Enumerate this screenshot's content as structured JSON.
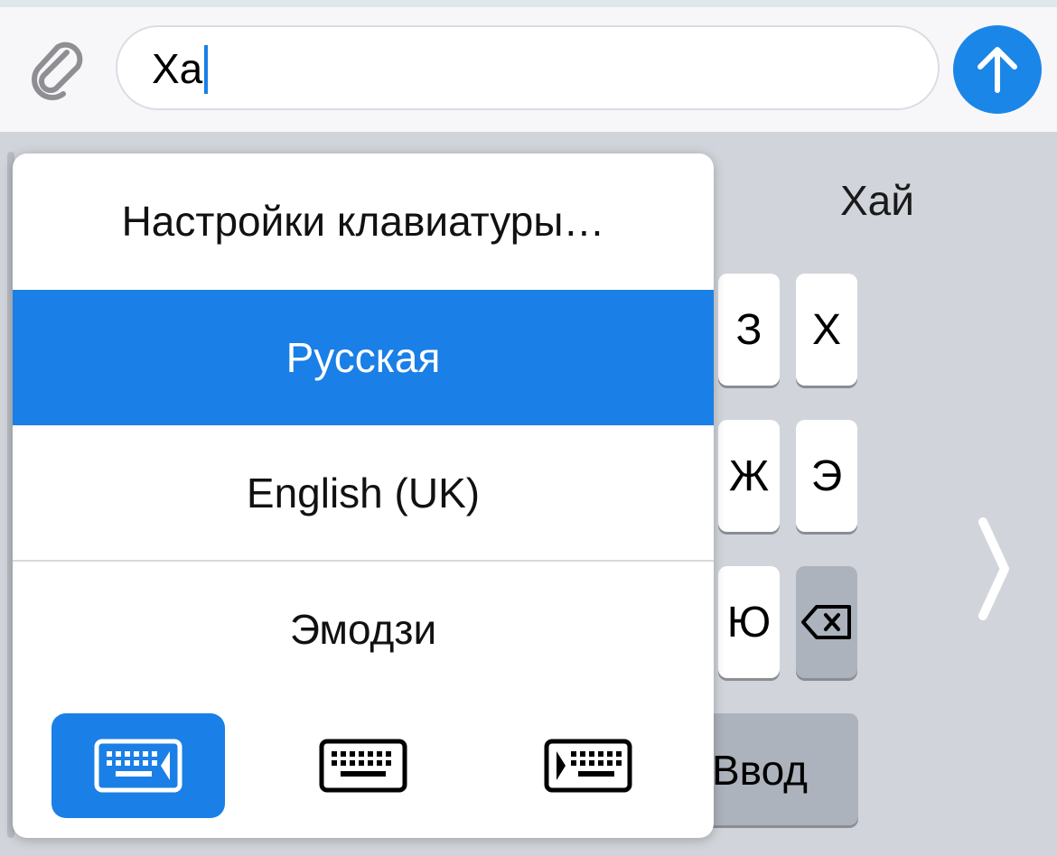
{
  "input_bar": {
    "message_text": "Xa",
    "attach_icon": "paperclip-icon",
    "send_icon": "arrow-up-icon",
    "send_color": "#1a86e8"
  },
  "keyboard": {
    "suggestion": "Хай",
    "keys_row1": [
      "З",
      "Х"
    ],
    "keys_row2": [
      "Ж",
      "Э"
    ],
    "keys_row3": [
      "Ю"
    ],
    "backspace_icon": "backspace-icon",
    "enter_label": "Ввод",
    "next_icon": "chevron-right-icon"
  },
  "popup": {
    "items": [
      {
        "label": "Настройки клавиатуры…",
        "selected": false
      },
      {
        "label": "Русская",
        "selected": true
      },
      {
        "label": "English (UK)",
        "selected": false
      },
      {
        "label": "Эмодзи",
        "selected": false
      }
    ],
    "accent_color": "#1a7fe6",
    "layout_buttons": [
      {
        "icon": "keyboard-left-icon",
        "active": true
      },
      {
        "icon": "keyboard-full-icon",
        "active": false
      },
      {
        "icon": "keyboard-right-icon",
        "active": false
      }
    ]
  }
}
